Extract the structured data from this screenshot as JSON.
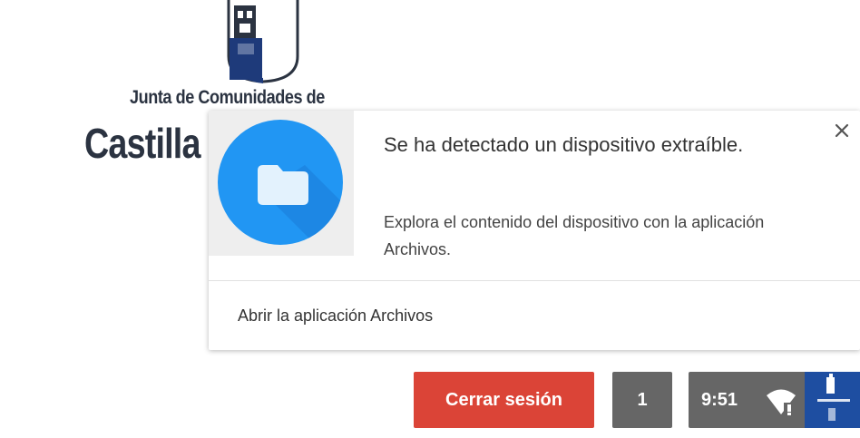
{
  "background_logo": {
    "line1": "Junta de Comunidades de",
    "line2": "Castilla"
  },
  "notification": {
    "title": "Se ha detectado un dispositivo extraíble.",
    "message": "Explora el contenido del dispositivo con la aplicación Archivos.",
    "action_label": "Abrir la aplicación Archivos",
    "icon": "folder-icon",
    "close_icon": "close-icon",
    "icon_color": "#2196f3"
  },
  "shelf": {
    "logout_label": "Cerrar sesión",
    "logout_color": "#db4437",
    "notification_count": "1",
    "time": "9:51",
    "wifi_icon": "wifi-alert-icon",
    "avatar_icon": "avatar-icon"
  }
}
